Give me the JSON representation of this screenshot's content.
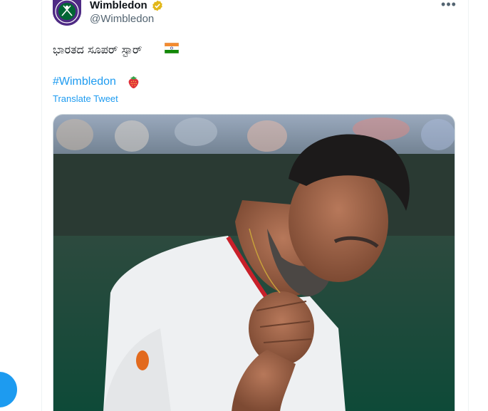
{
  "tweet": {
    "display_name": "Wimbledon",
    "handle": "@Wimbledon",
    "text": "ಭಾರತದ ಸೂಪರ್ ಸ್ಟಾರ್",
    "hashtag": "#Wimbledon",
    "translate_label": "Translate Tweet",
    "more_label": "•••"
  },
  "icons": {
    "avatar": "wimbledon-logo",
    "verified": "verified-badge-gold",
    "flag": "india-flag-emoji",
    "hashtag_emoji": "strawberry-emoji",
    "more": "more-options-icon"
  },
  "colors": {
    "link": "#1d9bf0",
    "secondary_text": "#536471",
    "verified_gold": "#e2b719",
    "wimbledon_purple": "#4e2a84",
    "wimbledon_green": "#006633"
  }
}
